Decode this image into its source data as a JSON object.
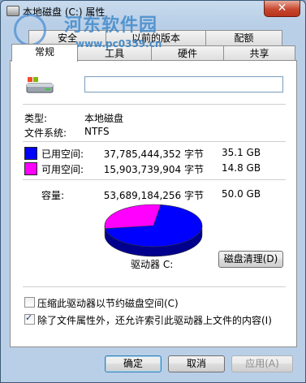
{
  "window": {
    "title": "本地磁盘 (C:) 属性",
    "close_glyph": "✕"
  },
  "watermark": {
    "brand": "河东软件园",
    "url": "www.pc0359.cn"
  },
  "tabs": {
    "row_top": [
      "安全",
      "以前的版本",
      "配额"
    ],
    "row_bottom": [
      "常规",
      "工具",
      "硬件",
      "共享"
    ],
    "active": "常规"
  },
  "general": {
    "drive_name_value": "",
    "type_label": "类型:",
    "type_value": "本地磁盘",
    "fs_label": "文件系统:",
    "fs_value": "NTFS",
    "used": {
      "label": "已用空间:",
      "bytes": "37,785,444,352 字节",
      "size": "35.1 GB",
      "color": "#0000ff"
    },
    "free": {
      "label": "可用空间:",
      "bytes": "15,903,739,904 字节",
      "size": "14.8 GB",
      "color": "#ff00ff"
    },
    "capacity": {
      "label": "容量:",
      "bytes": "53,689,184,256 字节",
      "size": "50.0 GB"
    },
    "used_fraction": 0.7038,
    "drive_label": "驱动器 C:",
    "cleanup_button": "磁盘清理(D)",
    "compress_label": "压缩此驱动器以节约磁盘空间(C)",
    "compress_checked": false,
    "index_label": "除了文件属性外，还允许索引此驱动器上文件的内容(I)",
    "index_checked": true
  },
  "buttons": {
    "ok": "确定",
    "cancel": "取消",
    "apply": "应用(A)"
  }
}
